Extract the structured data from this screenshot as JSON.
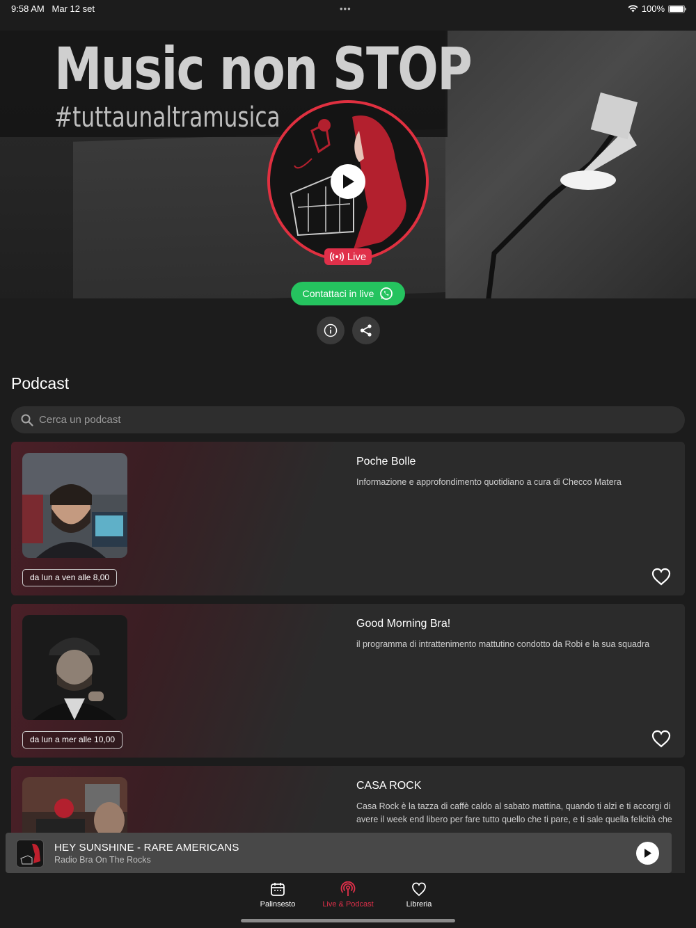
{
  "status_bar": {
    "time": "9:58 AM",
    "date": "Mar 12 set",
    "battery_percent": "100%",
    "battery_level": 1.0
  },
  "hero": {
    "banner_title": "Music non STOP",
    "banner_subtitle": "#tuttaunaltramusica",
    "live_label": "Live",
    "contact_label": "Contattaci in live"
  },
  "podcast_section": {
    "title": "Podcast",
    "search_placeholder": "Cerca un podcast"
  },
  "podcasts": [
    {
      "title": "Poche Bolle",
      "description": "Informazione e approfondimento quotidiano a cura di Checco Matera",
      "schedule": "da lun a ven alle 8,00"
    },
    {
      "title": "Good Morning Bra!",
      "description": "il programma di intrattenimento mattutino condotto da Robi e la sua squadra",
      "schedule": "da lun a mer alle 10,00"
    },
    {
      "title": "CASA ROCK",
      "description": "Casa Rock è la tazza di caffè caldo al sabato mattina, quando ti alzi e ti accorgi di avere il week end libero per fare tutto quello che ti pare, e ti sale quella felicità che solo il rock 'n roll sa darti.... musica e notizie sul e dal mondo del rock, tra passato"
    }
  ],
  "mini_player": {
    "track": "HEY SUNSHINE - RARE AMERICANS",
    "station": "Radio Bra On The Rocks"
  },
  "tab_bar": {
    "tabs": [
      {
        "label": "Palinsesto",
        "icon": "calendar-icon"
      },
      {
        "label": "Live & Podcast",
        "icon": "broadcast-icon",
        "active": true
      },
      {
        "label": "Libreria",
        "icon": "heart-icon"
      }
    ]
  },
  "colors": {
    "accent": "#e0304a",
    "whatsapp": "#25c35f",
    "background": "#1c1c1c",
    "card": "#2b2b2b"
  }
}
